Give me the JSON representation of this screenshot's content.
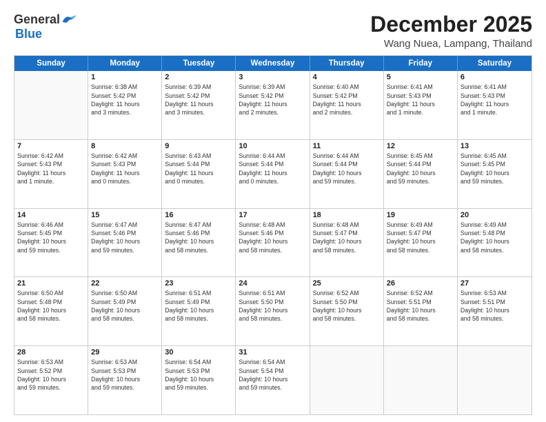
{
  "header": {
    "logo_general": "General",
    "logo_blue": "Blue",
    "main_title": "December 2025",
    "subtitle": "Wang Nuea, Lampang, Thailand"
  },
  "calendar": {
    "days_of_week": [
      "Sunday",
      "Monday",
      "Tuesday",
      "Wednesday",
      "Thursday",
      "Friday",
      "Saturday"
    ],
    "rows": [
      [
        {
          "day": "",
          "info": ""
        },
        {
          "day": "1",
          "info": "Sunrise: 6:38 AM\nSunset: 5:42 PM\nDaylight: 11 hours\nand 3 minutes."
        },
        {
          "day": "2",
          "info": "Sunrise: 6:39 AM\nSunset: 5:42 PM\nDaylight: 11 hours\nand 3 minutes."
        },
        {
          "day": "3",
          "info": "Sunrise: 6:39 AM\nSunset: 5:42 PM\nDaylight: 11 hours\nand 2 minutes."
        },
        {
          "day": "4",
          "info": "Sunrise: 6:40 AM\nSunset: 5:42 PM\nDaylight: 11 hours\nand 2 minutes."
        },
        {
          "day": "5",
          "info": "Sunrise: 6:41 AM\nSunset: 5:43 PM\nDaylight: 11 hours\nand 1 minute."
        },
        {
          "day": "6",
          "info": "Sunrise: 6:41 AM\nSunset: 5:43 PM\nDaylight: 11 hours\nand 1 minute."
        }
      ],
      [
        {
          "day": "7",
          "info": "Sunrise: 6:42 AM\nSunset: 5:43 PM\nDaylight: 11 hours\nand 1 minute."
        },
        {
          "day": "8",
          "info": "Sunrise: 6:42 AM\nSunset: 5:43 PM\nDaylight: 11 hours\nand 0 minutes."
        },
        {
          "day": "9",
          "info": "Sunrise: 6:43 AM\nSunset: 5:44 PM\nDaylight: 11 hours\nand 0 minutes."
        },
        {
          "day": "10",
          "info": "Sunrise: 6:44 AM\nSunset: 5:44 PM\nDaylight: 11 hours\nand 0 minutes."
        },
        {
          "day": "11",
          "info": "Sunrise: 6:44 AM\nSunset: 5:44 PM\nDaylight: 10 hours\nand 59 minutes."
        },
        {
          "day": "12",
          "info": "Sunrise: 6:45 AM\nSunset: 5:44 PM\nDaylight: 10 hours\nand 59 minutes."
        },
        {
          "day": "13",
          "info": "Sunrise: 6:45 AM\nSunset: 5:45 PM\nDaylight: 10 hours\nand 59 minutes."
        }
      ],
      [
        {
          "day": "14",
          "info": "Sunrise: 6:46 AM\nSunset: 5:45 PM\nDaylight: 10 hours\nand 59 minutes."
        },
        {
          "day": "15",
          "info": "Sunrise: 6:47 AM\nSunset: 5:46 PM\nDaylight: 10 hours\nand 59 minutes."
        },
        {
          "day": "16",
          "info": "Sunrise: 6:47 AM\nSunset: 5:46 PM\nDaylight: 10 hours\nand 58 minutes."
        },
        {
          "day": "17",
          "info": "Sunrise: 6:48 AM\nSunset: 5:46 PM\nDaylight: 10 hours\nand 58 minutes."
        },
        {
          "day": "18",
          "info": "Sunrise: 6:48 AM\nSunset: 5:47 PM\nDaylight: 10 hours\nand 58 minutes."
        },
        {
          "day": "19",
          "info": "Sunrise: 6:49 AM\nSunset: 5:47 PM\nDaylight: 10 hours\nand 58 minutes."
        },
        {
          "day": "20",
          "info": "Sunrise: 6:49 AM\nSunset: 5:48 PM\nDaylight: 10 hours\nand 58 minutes."
        }
      ],
      [
        {
          "day": "21",
          "info": "Sunrise: 6:50 AM\nSunset: 5:48 PM\nDaylight: 10 hours\nand 58 minutes."
        },
        {
          "day": "22",
          "info": "Sunrise: 6:50 AM\nSunset: 5:49 PM\nDaylight: 10 hours\nand 58 minutes."
        },
        {
          "day": "23",
          "info": "Sunrise: 6:51 AM\nSunset: 5:49 PM\nDaylight: 10 hours\nand 58 minutes."
        },
        {
          "day": "24",
          "info": "Sunrise: 6:51 AM\nSunset: 5:50 PM\nDaylight: 10 hours\nand 58 minutes."
        },
        {
          "day": "25",
          "info": "Sunrise: 6:52 AM\nSunset: 5:50 PM\nDaylight: 10 hours\nand 58 minutes."
        },
        {
          "day": "26",
          "info": "Sunrise: 6:52 AM\nSunset: 5:51 PM\nDaylight: 10 hours\nand 58 minutes."
        },
        {
          "day": "27",
          "info": "Sunrise: 6:53 AM\nSunset: 5:51 PM\nDaylight: 10 hours\nand 58 minutes."
        }
      ],
      [
        {
          "day": "28",
          "info": "Sunrise: 6:53 AM\nSunset: 5:52 PM\nDaylight: 10 hours\nand 59 minutes."
        },
        {
          "day": "29",
          "info": "Sunrise: 6:53 AM\nSunset: 5:53 PM\nDaylight: 10 hours\nand 59 minutes."
        },
        {
          "day": "30",
          "info": "Sunrise: 6:54 AM\nSunset: 5:53 PM\nDaylight: 10 hours\nand 59 minutes."
        },
        {
          "day": "31",
          "info": "Sunrise: 6:54 AM\nSunset: 5:54 PM\nDaylight: 10 hours\nand 59 minutes."
        },
        {
          "day": "",
          "info": ""
        },
        {
          "day": "",
          "info": ""
        },
        {
          "day": "",
          "info": ""
        }
      ]
    ]
  }
}
